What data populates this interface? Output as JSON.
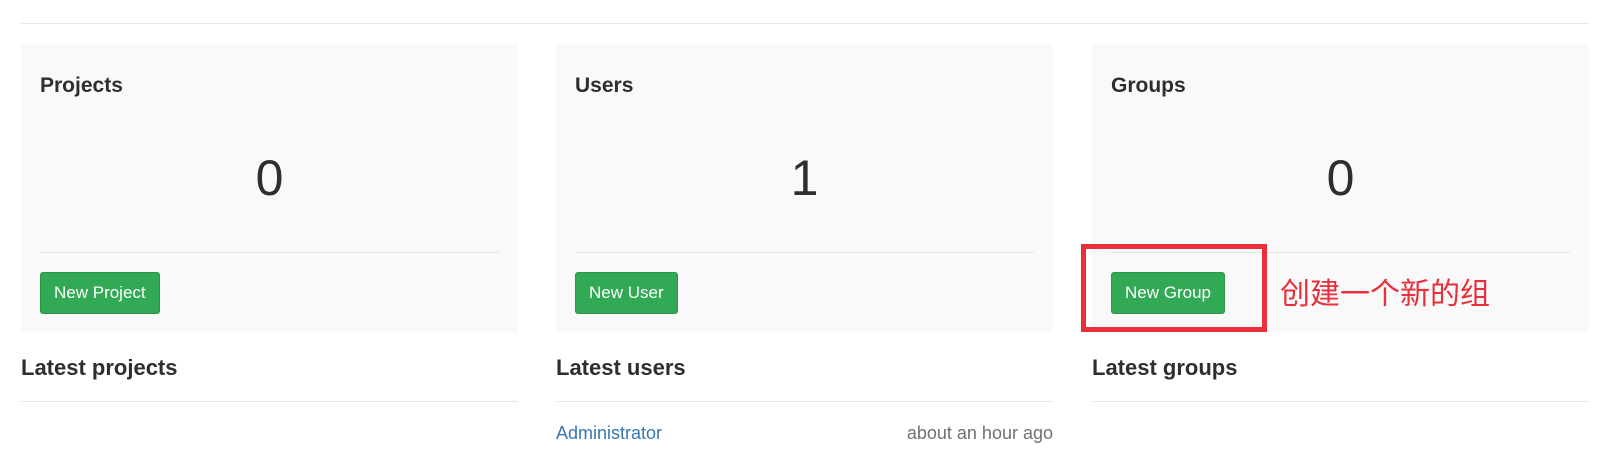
{
  "panels": {
    "projects": {
      "title": "Projects",
      "count": "0",
      "button_label": "New Project"
    },
    "users": {
      "title": "Users",
      "count": "1",
      "button_label": "New User"
    },
    "groups": {
      "title": "Groups",
      "count": "0",
      "button_label": "New Group"
    }
  },
  "latest": {
    "projects": {
      "title": "Latest projects",
      "items": []
    },
    "users": {
      "title": "Latest users",
      "items": [
        {
          "name": "Administrator",
          "time": "about an hour ago"
        }
      ]
    },
    "groups": {
      "title": "Latest groups",
      "items": []
    }
  },
  "annotation": {
    "text": "创建一个新的组",
    "color": "#e8303a"
  },
  "colors": {
    "button_green": "#32a955",
    "link_blue": "#3777b0",
    "panel_bg": "#f9f9f9"
  }
}
